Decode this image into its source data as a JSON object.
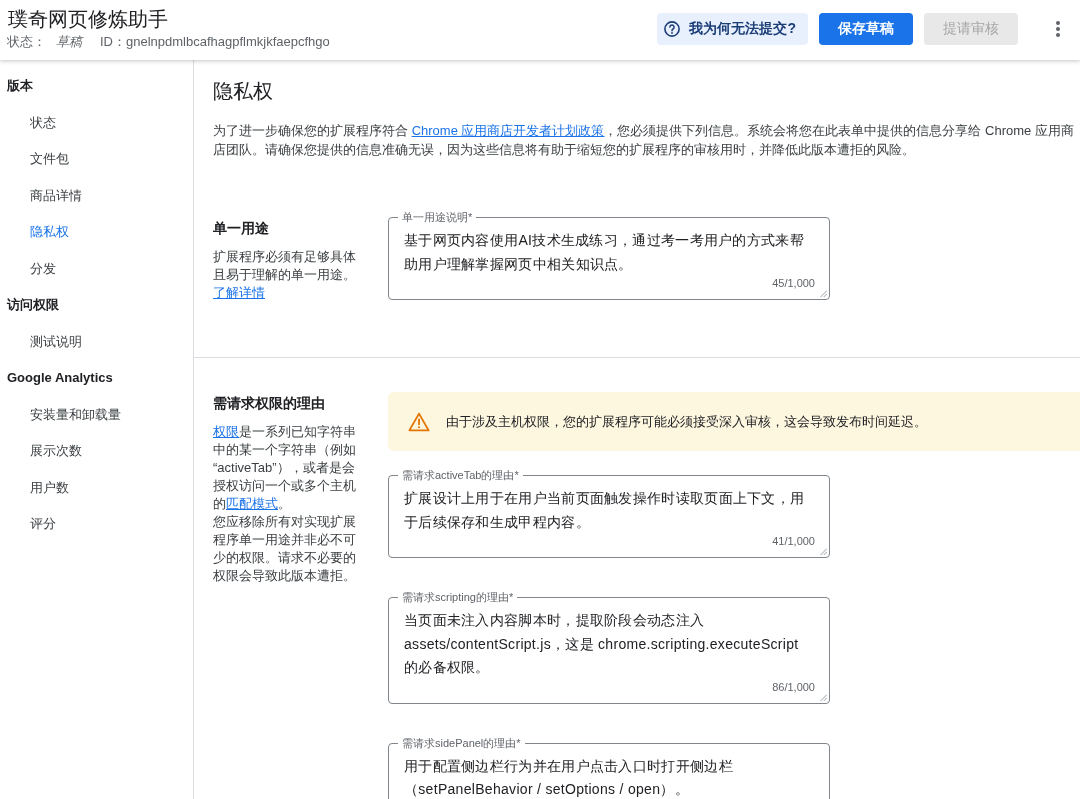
{
  "header": {
    "title": "璞奇网页修炼助手",
    "status_label": "状态：",
    "status": "草稿",
    "id_label": "ID：",
    "id": "gnelnpdmlbcafhagpflmkjkfaepcfhgo"
  },
  "actions": [
    {
      "kind": "help",
      "label": "我为何无法提交?",
      "disabled": false
    },
    {
      "kind": "primary",
      "label": "保存草稿",
      "disabled": false
    },
    {
      "kind": "secondary",
      "label": "提请审核",
      "disabled": true
    }
  ],
  "sidebar": {
    "sections": [
      {
        "heading": "版本",
        "items": [
          {
            "label": "状态",
            "selected": false
          },
          {
            "label": "文件包",
            "selected": false
          },
          {
            "label": "商品详情",
            "selected": false
          },
          {
            "label": "隐私权",
            "selected": true
          },
          {
            "label": "分发",
            "selected": false
          }
        ]
      },
      {
        "heading": "访问权限",
        "items": [
          {
            "label": "测试说明",
            "selected": false
          }
        ]
      },
      {
        "heading": "Google Analytics",
        "items": [
          {
            "label": "安装量和卸载量",
            "selected": false
          },
          {
            "label": "展示次数",
            "selected": false
          },
          {
            "label": "用户数",
            "selected": false
          },
          {
            "label": "评分",
            "selected": false
          }
        ]
      }
    ]
  },
  "page": {
    "title": "隐私权",
    "intro": [
      {
        "kind": "text",
        "text": "为了进一步确保您的扩展程序符合 "
      },
      {
        "kind": "link",
        "text": "Chrome 应用商店开发者计划政策"
      },
      {
        "kind": "text",
        "text": "，您必须提供下列信息。系统会将您在此表单中提供的信息分享给 Chrome 应用商店团队。请确保您提供的信息准确无误，因为这些信息将有助于缩短您的扩展程序的审核用时，并降低此版本遭拒的风险。"
      }
    ]
  },
  "sections": [
    {
      "heading": "单一用途",
      "description": [
        [
          {
            "kind": "text",
            "text": "扩展程序必须有足够具体且易于理解的单一用途。"
          }
        ],
        [
          {
            "kind": "link",
            "text": "了解详情"
          }
        ]
      ],
      "fields": [
        {
          "label": "单一用途说明*",
          "value": "基于网页内容使用AI技术生成练习，通过考一考用户的方式来帮助用户理解掌握网页中相关知识点。",
          "counter": "45/1,000"
        }
      ]
    },
    {
      "heading": "需请求权限的理由",
      "description": [
        [
          {
            "kind": "link",
            "text": "权限"
          },
          {
            "kind": "text",
            "text": "是一系列已知字符串中的某一个字符串（例如“activeTab”），或者是会授权访问一个或多个主机的"
          },
          {
            "kind": "link",
            "text": "匹配模式"
          },
          {
            "kind": "text",
            "text": "。"
          }
        ],
        [
          {
            "kind": "text",
            "text": "您应移除所有对实现扩展程序单一用途并非必不可少的权限。请求不必要的权限会导致此版本遭拒。"
          }
        ]
      ],
      "notice": {
        "kind": "warning",
        "text": "由于涉及主机权限，您的扩展程序可能必须接受深入审核，这会导致发布时间延迟。"
      },
      "fields": [
        {
          "label": "需请求activeTab的理由*",
          "value": "扩展设计上用于在用户当前页面触发操作时读取页面上下文，用于后续保存和生成甲程内容。",
          "counter": "41/1,000"
        },
        {
          "label": "需请求scripting的理由*",
          "value": "当页面未注入内容脚本时，提取阶段会动态注入assets/contentScript.js，这是 chrome.scripting.executeScript的必备权限。",
          "counter": "86/1,000"
        },
        {
          "label": "需请求sidePanel的理由*",
          "value": "用于配置侧边栏行为并在用户点击入口时打开侧边栏（setPanelBehavior / setOptions / open）。"
        }
      ]
    }
  ]
}
